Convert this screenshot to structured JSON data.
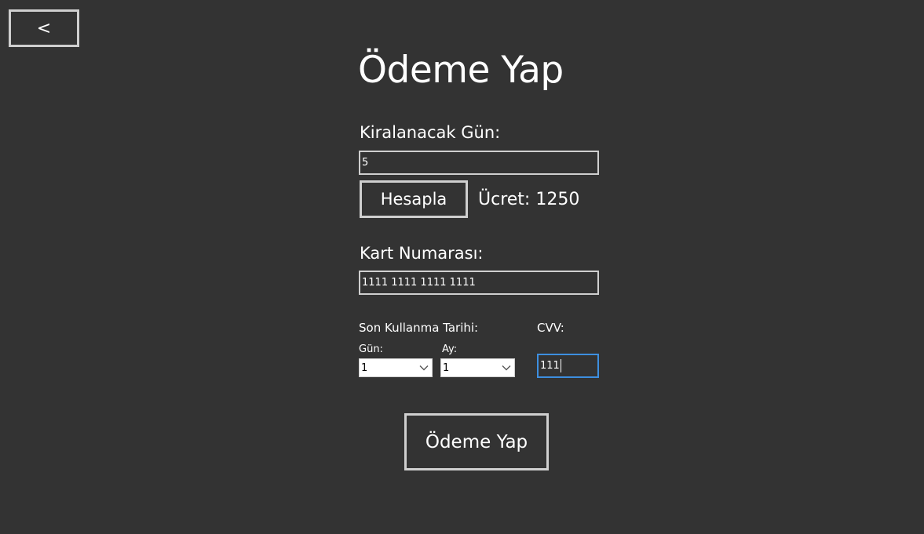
{
  "nav": {
    "back_label": "<"
  },
  "page": {
    "title": "Ödeme Yap"
  },
  "rental": {
    "days_label": "Kiralanacak Gün:",
    "days_value": "5",
    "calc_button": "Hesapla",
    "fee_text": "Ücret: 1250"
  },
  "card": {
    "number_label": "Kart Numarası:",
    "number_value": "1111 1111 1111 1111",
    "expiry_label": "Son Kullanma Tarihi:",
    "day_label": "Gün:",
    "day_value": "1",
    "month_label": "Ay:",
    "month_value": "1",
    "cvv_label": "CVV:",
    "cvv_value": "111"
  },
  "actions": {
    "pay_button": "Ödeme Yap"
  },
  "icons": {
    "dropdown": "chevron-down-icon"
  },
  "colors": {
    "background": "#333333",
    "border": "#cfcfcf",
    "focus": "#3d8fe0",
    "text": "#ffffff"
  }
}
